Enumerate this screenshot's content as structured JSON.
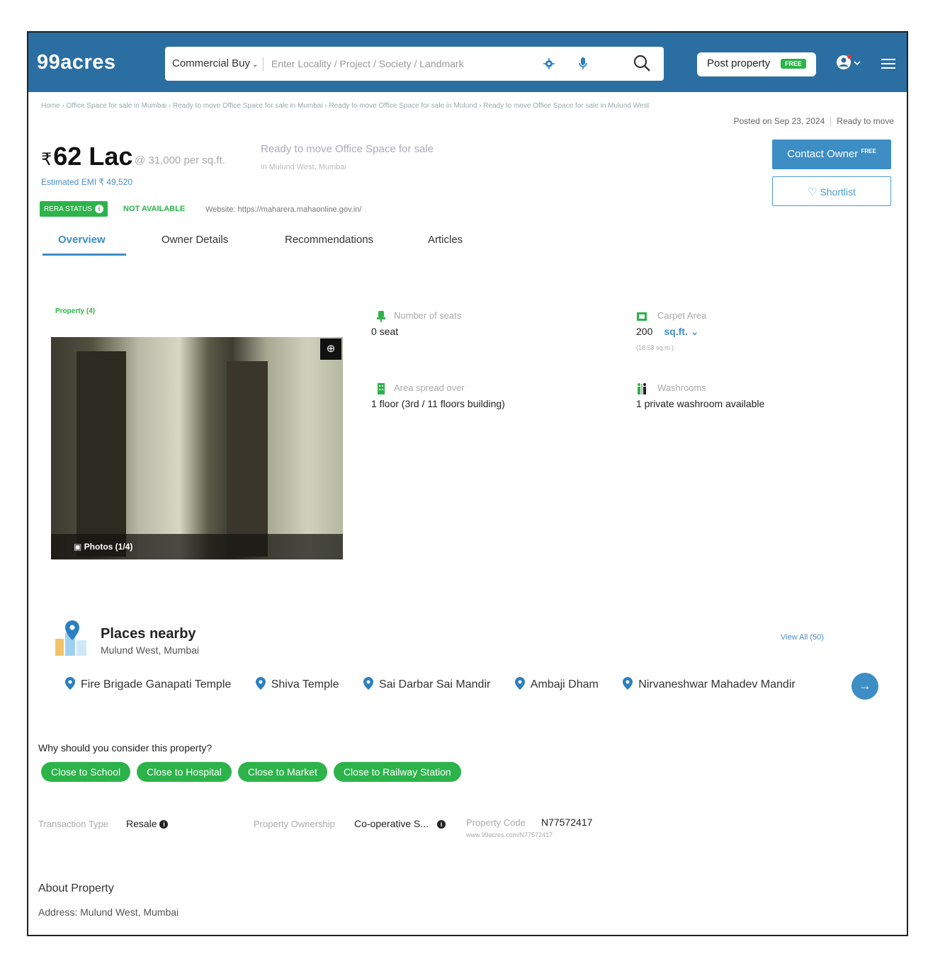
{
  "header": {
    "logo": "99acres",
    "search_type": "Commercial Buy",
    "search_placeholder": "Enter Locality / Project / Society / Landmark",
    "post_property_label": "Post property",
    "post_property_badge": "FREE"
  },
  "breadcrumb": "Home › Office Space for sale in Mumbai › Ready to move Office Space for sale in Mumbai › Ready to move Office Space for sale in Mulund › Ready to move Office Space for sale in Mulund West",
  "posted_on": "Posted on Sep 23, 2024",
  "status": "Ready to move",
  "listing": {
    "currency_symbol": "₹",
    "price": "62 Lac",
    "price_per_sqft": "@ 31,000 per sq.ft.",
    "title": "Ready to move Office Space for sale",
    "location": "in Mulund West, Mumbai",
    "emi": "Estimated EMI ₹ 49,520",
    "rera_label": "RERA STATUS",
    "rera_value": "NOT AVAILABLE",
    "website": "Website: https://maharera.mahaonline.gov.in/"
  },
  "actions": {
    "contact_label": "Contact Owner",
    "contact_badge": "FREE",
    "shortlist_label": "Shortlist"
  },
  "tabs": [
    "Overview",
    "Owner Details",
    "Recommendations",
    "Articles"
  ],
  "gallery": {
    "label": "Property (4)",
    "photos_label": "Photos (1/4)"
  },
  "features": {
    "seats_label": "Number of seats",
    "seats_value": "0 seat",
    "carpet_label": "Carpet Area",
    "carpet_value": "200",
    "carpet_unit": "sq.ft.",
    "carpet_sub": "(18.58 sq.m.)",
    "floor_label": "Area spread over",
    "floor_value": "1 floor (3rd / 11 floors building)",
    "washroom_label": "Washrooms",
    "washroom_value": "1 private washroom available"
  },
  "places_nearby": {
    "title": "Places nearby",
    "subtitle": "Mulund West, Mumbai",
    "view_all": "View All (50)",
    "items": [
      "Fire Brigade Ganapati Temple",
      "Shiva Temple",
      "Sai Darbar Sai Mandir",
      "Ambaji Dham",
      "Nirvaneshwar Mahadev Mandir"
    ]
  },
  "why_consider": {
    "title": "Why should you consider this property?",
    "chips": [
      "Close to School",
      "Close to Hospital",
      "Close to Market",
      "Close to Railway Station"
    ]
  },
  "details": {
    "transaction_label": "Transaction Type",
    "transaction_value": "Resale",
    "ownership_label": "Property Ownership",
    "ownership_value": "Co-operative S...",
    "code_label": "Property Code",
    "code_value": "N77572417",
    "code_url": "www.99acres.com/N77572417"
  },
  "about": {
    "title": "About Property",
    "address": "Address: Mulund West, Mumbai"
  },
  "colors": {
    "header_bg": "#2b6ea1",
    "accent_blue": "#3d8ec4",
    "green": "#2cb34a"
  }
}
